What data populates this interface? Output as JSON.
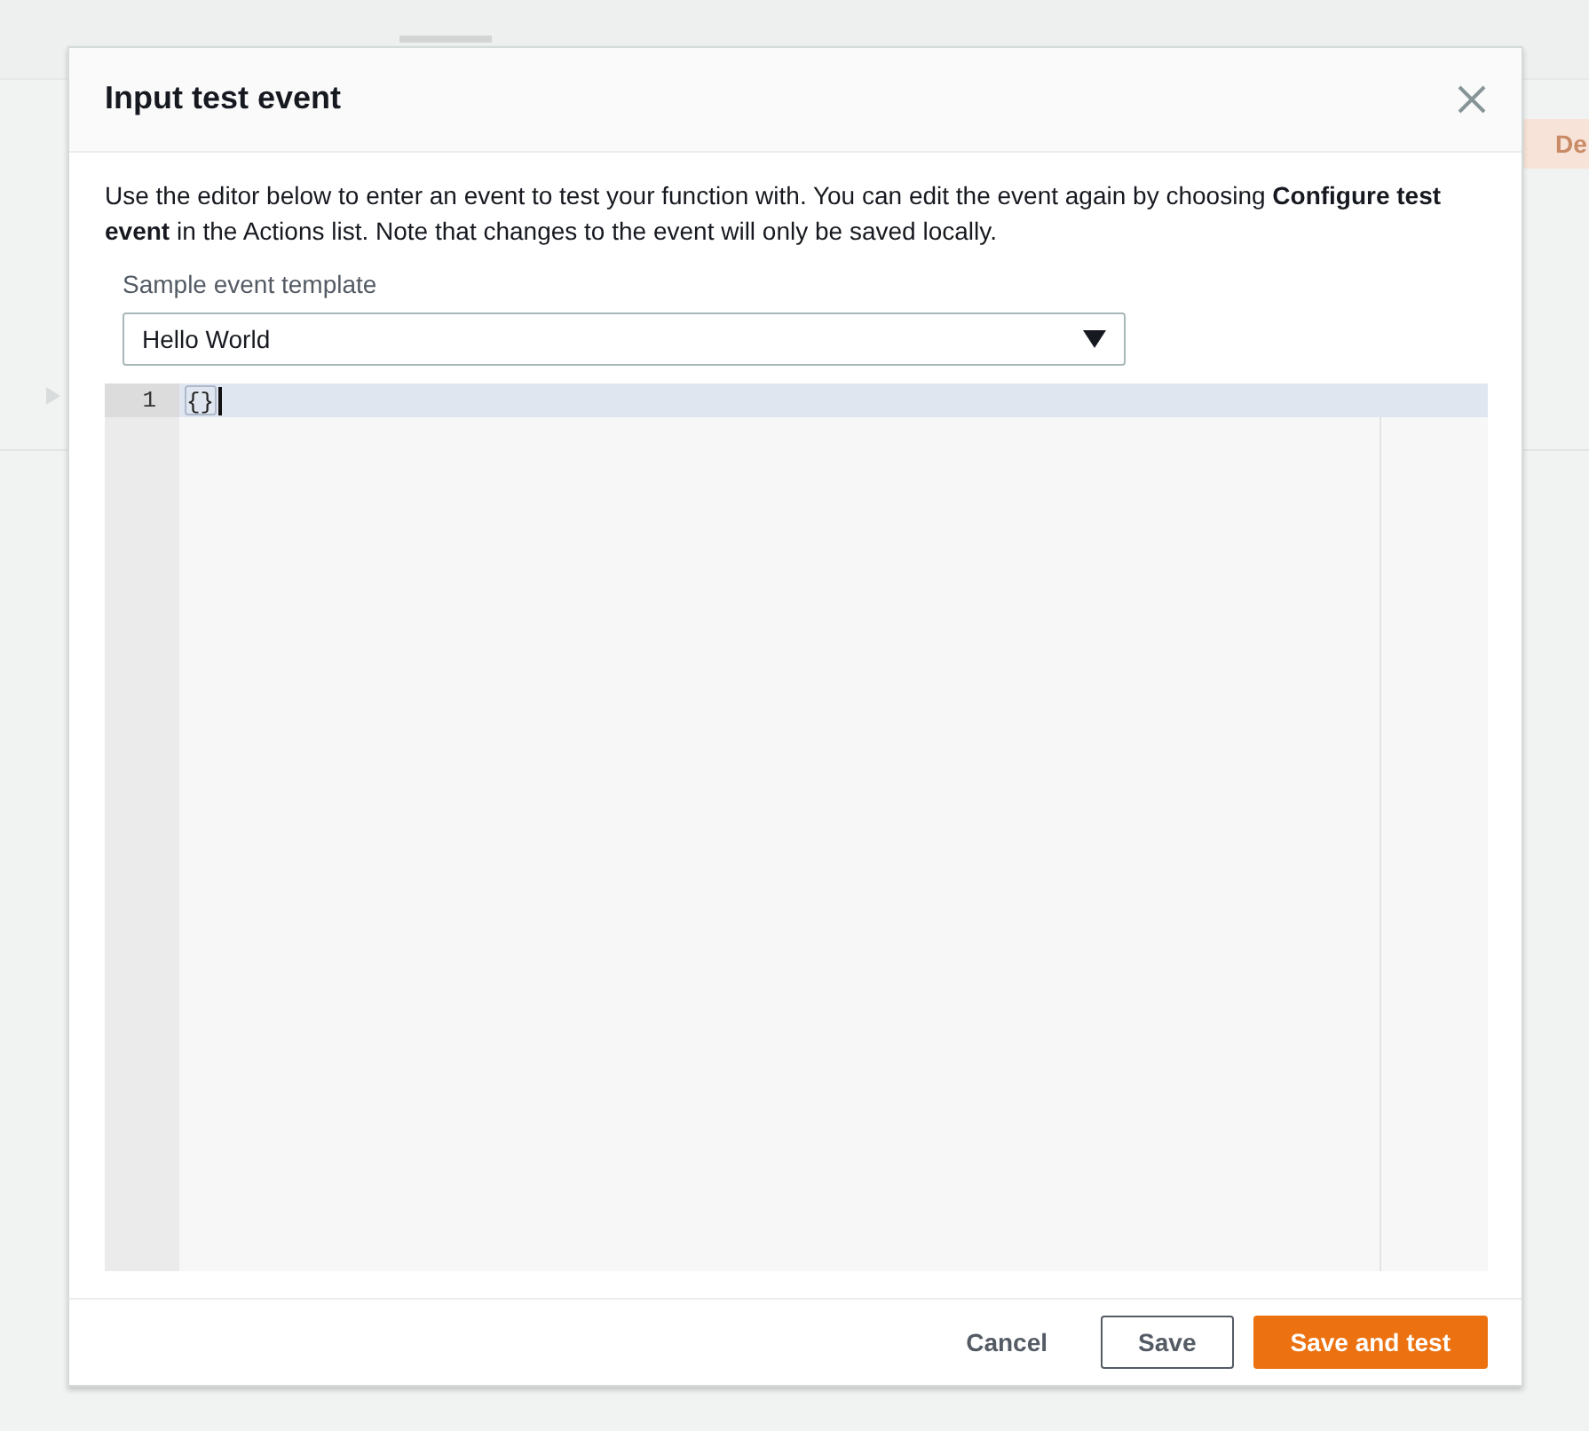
{
  "background": {
    "button_label": "De"
  },
  "modal": {
    "title": "Input test event",
    "description": "Use the editor below to enter an event to test your function with. You can edit the event again by choosing **Configure test event** in the Actions list. Note that changes to the event will only be saved locally.",
    "template_label": "Sample event template",
    "template_select": {
      "value": "Hello World"
    },
    "editor": {
      "lines": [
        {
          "number": "1",
          "text": "{}",
          "active": true
        }
      ]
    },
    "buttons": [
      {
        "label": "Cancel",
        "kind": "link"
      },
      {
        "label": "Save",
        "kind": "secondary"
      },
      {
        "label": "Save and test",
        "kind": "primary"
      }
    ]
  }
}
